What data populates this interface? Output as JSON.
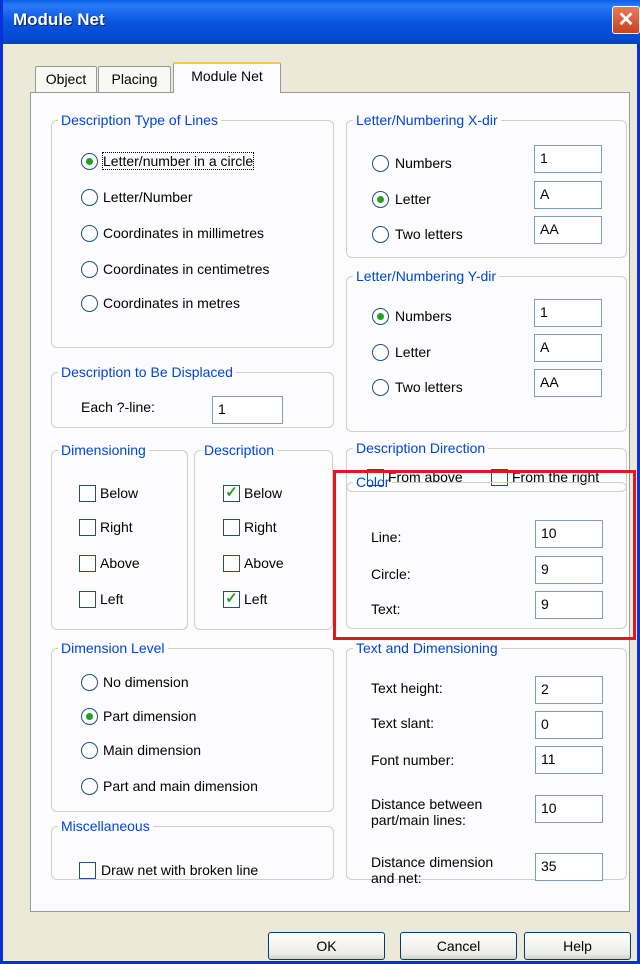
{
  "window": {
    "title": "Module Net",
    "close_glyph": "✕"
  },
  "tabs": [
    {
      "label": "Object"
    },
    {
      "label": "Placing"
    },
    {
      "label": "Module Net"
    }
  ],
  "desc_type": {
    "legend": "Description Type of Lines",
    "options": [
      {
        "label": "Letter/number in a circle",
        "selected": true
      },
      {
        "label": "Letter/Number",
        "selected": false
      },
      {
        "label": "Coordinates in millimetres",
        "selected": false
      },
      {
        "label": "Coordinates in centimetres",
        "selected": false
      },
      {
        "label": "Coordinates in metres",
        "selected": false
      }
    ]
  },
  "letter_x": {
    "legend": "Letter/Numbering X-dir",
    "options": [
      {
        "label": "Numbers",
        "value": "1",
        "selected": false
      },
      {
        "label": "Letter",
        "value": "A",
        "selected": true
      },
      {
        "label": "Two letters",
        "value": "AA",
        "selected": false
      }
    ]
  },
  "letter_y": {
    "legend": "Letter/Numbering Y-dir",
    "options": [
      {
        "label": "Numbers",
        "value": "1",
        "selected": true
      },
      {
        "label": "Letter",
        "value": "A",
        "selected": false
      },
      {
        "label": "Two letters",
        "value": "AA",
        "selected": false
      }
    ]
  },
  "displaced": {
    "legend": "Description to Be Displaced",
    "label": "Each ?-line:",
    "value": "1"
  },
  "dimensioning": {
    "legend": "Dimensioning",
    "items": [
      {
        "label": "Below",
        "checked": false
      },
      {
        "label": "Right",
        "checked": false
      },
      {
        "label": "Above",
        "checked": false
      },
      {
        "label": "Left",
        "checked": false
      }
    ]
  },
  "description": {
    "legend": "Description",
    "items": [
      {
        "label": "Below",
        "checked": true
      },
      {
        "label": "Right",
        "checked": false
      },
      {
        "label": "Above",
        "checked": false
      },
      {
        "label": "Left",
        "checked": true
      }
    ]
  },
  "desc_direction": {
    "legend": "Description Direction",
    "items": [
      {
        "label": "From above",
        "checked": false
      },
      {
        "label": "From the right",
        "checked": false
      }
    ]
  },
  "color": {
    "legend": "Color",
    "fields": [
      {
        "label": "Line:",
        "value": "10"
      },
      {
        "label": "Circle:",
        "value": "9"
      },
      {
        "label": "Text:",
        "value": "9"
      }
    ]
  },
  "dim_level": {
    "legend": "Dimension Level",
    "options": [
      {
        "label": "No dimension",
        "selected": false
      },
      {
        "label": "Part dimension",
        "selected": true
      },
      {
        "label": "Main dimension",
        "selected": false
      },
      {
        "label": "Part and main dimension",
        "selected": false
      }
    ]
  },
  "text_dim": {
    "legend": "Text and Dimensioning",
    "fields": [
      {
        "label": "Text height:",
        "value": "2"
      },
      {
        "label": "Text slant:",
        "value": "0"
      },
      {
        "label": "Font number:",
        "value": "11"
      },
      {
        "label_line1": "Distance between",
        "label_line2": "part/main lines:",
        "value": "10"
      },
      {
        "label_line1": "Distance dimension",
        "label_line2": "and net:",
        "value": "35"
      }
    ]
  },
  "misc": {
    "legend": "Miscellaneous",
    "checkbox_label": "Draw net with broken line",
    "checked": false
  },
  "buttons": {
    "ok": "OK",
    "cancel": "Cancel",
    "help": "Help"
  },
  "colors": {
    "legend_blue": "#0046d5",
    "highlight_red": "#e0181e",
    "titlebar_blue": "#0a54e0",
    "check_green": "#21a121"
  }
}
